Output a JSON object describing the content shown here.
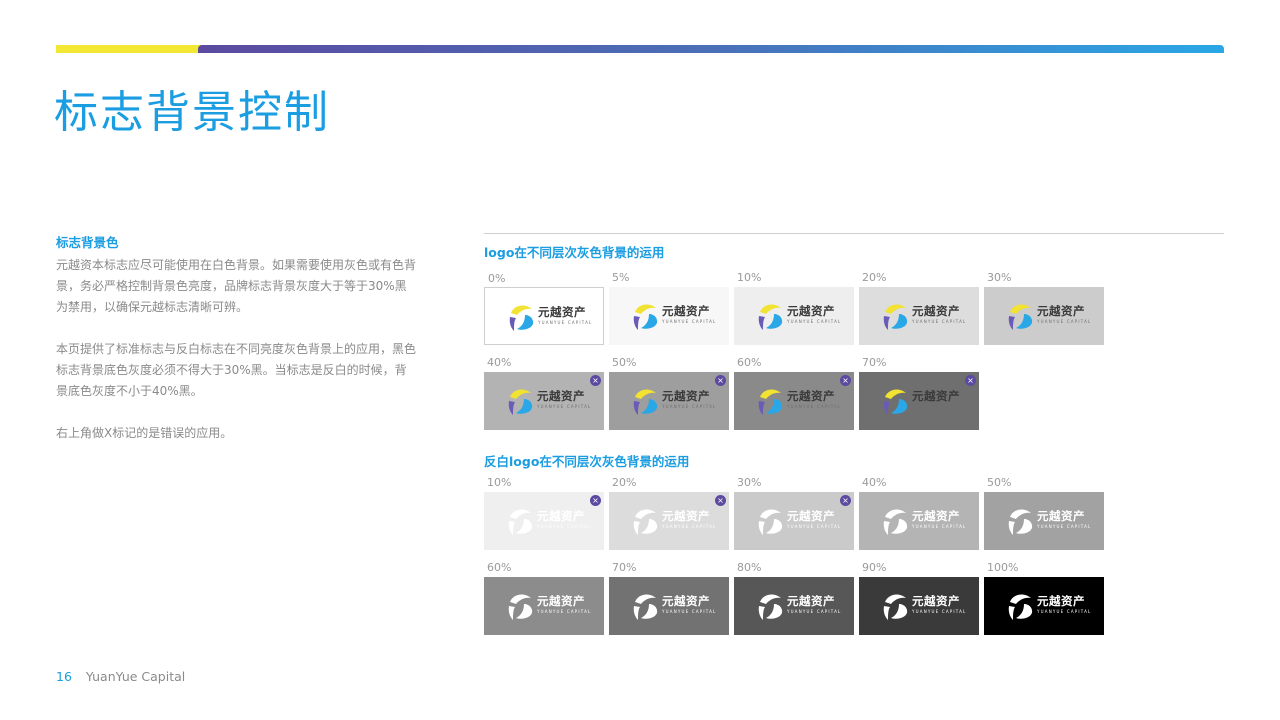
{
  "title": "标志背景控制",
  "left": {
    "heading": "标志背景色",
    "paragraphs": [
      "元越资本标志应尽可能使用在白色背景。如果需要使用灰色或有色背景，务必严格控制背景色亮度，品牌标志背景灰度大于等于30%黑为禁用，以确保元越标志清晰可辨。",
      "本页提供了标准标志与反白标志在不同亮度灰色背景上的应用，黑色标志背景底色灰度必须不得大于30%黑。当标志是反白的时候，背景底色灰度不小于40%黑。",
      "右上角做X标记的是错误的应用。"
    ]
  },
  "logo": {
    "name_cn": "元越资产",
    "name_en": "YUANYUE CAPITAL"
  },
  "error_mark": "×",
  "groups": [
    {
      "title": "logo在不同层次灰色背景的运用",
      "variant": "color",
      "swatches": [
        {
          "label": "0%",
          "bg": "#ffffff",
          "error": false
        },
        {
          "label": "5%",
          "bg": "#f7f7f7",
          "error": false
        },
        {
          "label": "10%",
          "bg": "#eeeeee",
          "error": false
        },
        {
          "label": "20%",
          "bg": "#dddddd",
          "error": false
        },
        {
          "label": "30%",
          "bg": "#cccccc",
          "error": false
        },
        {
          "label": "40%",
          "bg": "#b3b3b3",
          "error": true
        },
        {
          "label": "50%",
          "bg": "#9e9e9e",
          "error": true
        },
        {
          "label": "60%",
          "bg": "#8a8a8a",
          "error": true
        },
        {
          "label": "70%",
          "bg": "#6f6f6f",
          "error": true
        }
      ]
    },
    {
      "title": "反白logo在不同层次灰色背景的运用",
      "variant": "white",
      "swatches": [
        {
          "label": "10%",
          "bg": "#efefef",
          "error": true
        },
        {
          "label": "20%",
          "bg": "#dcdcdc",
          "error": true
        },
        {
          "label": "30%",
          "bg": "#cacaca",
          "error": true
        },
        {
          "label": "40%",
          "bg": "#b4b4b4",
          "error": false
        },
        {
          "label": "50%",
          "bg": "#a2a2a2",
          "error": false
        },
        {
          "label": "60%",
          "bg": "#8c8c8c",
          "error": false
        },
        {
          "label": "70%",
          "bg": "#727272",
          "error": false
        },
        {
          "label": "80%",
          "bg": "#575757",
          "error": false
        },
        {
          "label": "90%",
          "bg": "#3a3a3a",
          "error": false
        },
        {
          "label": "100%",
          "bg": "#000000",
          "error": false
        }
      ]
    }
  ],
  "colors": {
    "accent": "#1b9de1",
    "yellow": "#f2e834",
    "purple": "#5b4aa0",
    "logo_yellow": "#f2e231",
    "logo_blue": "#2aa7e6",
    "logo_purple": "#6a5bb8"
  },
  "footer": {
    "page": "16",
    "brand": "YuanYue Capital"
  }
}
